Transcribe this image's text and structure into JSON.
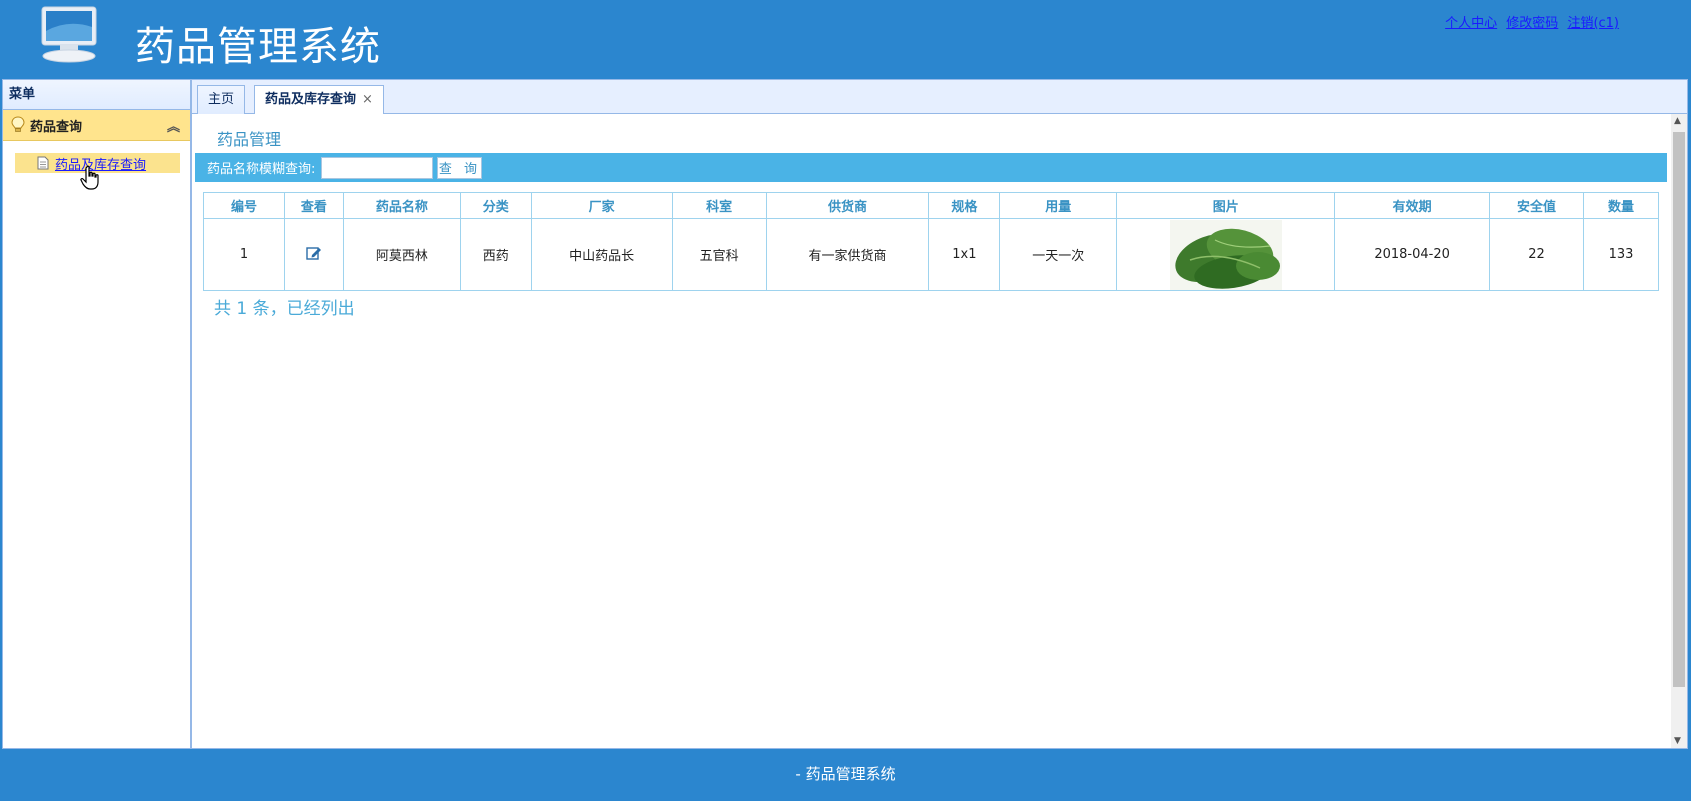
{
  "header": {
    "title": "药品管理系统",
    "links": [
      "个人中心",
      "修改密码",
      "注销(c1)"
    ]
  },
  "sidebar": {
    "title": "菜单",
    "group": "药品查询",
    "items": [
      {
        "label": "药品及库存查询"
      }
    ]
  },
  "tabs": [
    {
      "label": "主页"
    },
    {
      "label": "药品及库存查询",
      "close": "×"
    }
  ],
  "main": {
    "section_title": "药品管理",
    "search": {
      "label": "药品名称模糊查询:",
      "value": "",
      "button": "查 询"
    },
    "table": {
      "columns": [
        "编号",
        "查看",
        "药品名称",
        "分类",
        "厂家",
        "科室",
        "供货商",
        "规格",
        "用量",
        "图片",
        "有效期",
        "安全值",
        "数量"
      ],
      "rows": [
        {
          "id": "1",
          "name": "阿莫西林",
          "category": "西药",
          "maker": "中山药品长",
          "dept": "五官科",
          "supplier": "有一家供货商",
          "spec": "1x1",
          "dosage": "一天一次",
          "expiry": "2018-04-20",
          "safety": "22",
          "qty": "133"
        }
      ]
    },
    "total": "共 1 条，已经列出"
  },
  "footer": {
    "text": "- 药品管理系统"
  },
  "colors": {
    "header": "#2b86cf",
    "accent": "#4ab3e6",
    "menu_highlight": "#ffe48d"
  }
}
